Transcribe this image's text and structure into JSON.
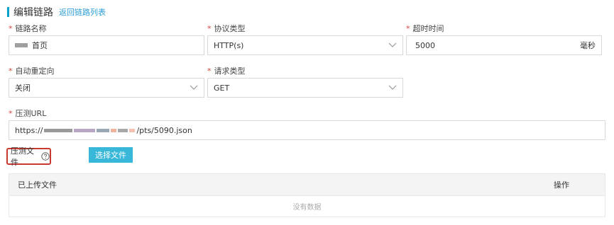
{
  "header": {
    "title": "编辑链路",
    "back_link": "返回链路列表"
  },
  "form": {
    "link_name": {
      "label": "链路名称",
      "required_mark": "*",
      "value": "首页"
    },
    "protocol": {
      "label": "协议类型",
      "required_mark": "*",
      "value": "HTTP(s)"
    },
    "timeout": {
      "label": "超时时间",
      "required_mark": "*",
      "value": "5000",
      "unit": "毫秒"
    },
    "redirect": {
      "label": "自动重定向",
      "required_mark": "*",
      "value": "关闭"
    },
    "request_type": {
      "label": "请求类型",
      "required_mark": "*",
      "value": "GET"
    },
    "url": {
      "label": "压测URL",
      "required_mark": "*",
      "prefix": "https://",
      "suffix": "/pts/5090.json"
    }
  },
  "file": {
    "label": "压测文件",
    "choose_button": "选择文件"
  },
  "table": {
    "columns": [
      "已上传文件",
      "操作"
    ],
    "empty_text": "没有数据"
  },
  "colors": {
    "accent": "#00a2ca",
    "button": "#38b7d9",
    "required": "#e1473c",
    "highlight_border": "#c83a2f"
  },
  "icons": {
    "dropdown": "chevron-down-icon",
    "help": "question-circle-icon"
  }
}
